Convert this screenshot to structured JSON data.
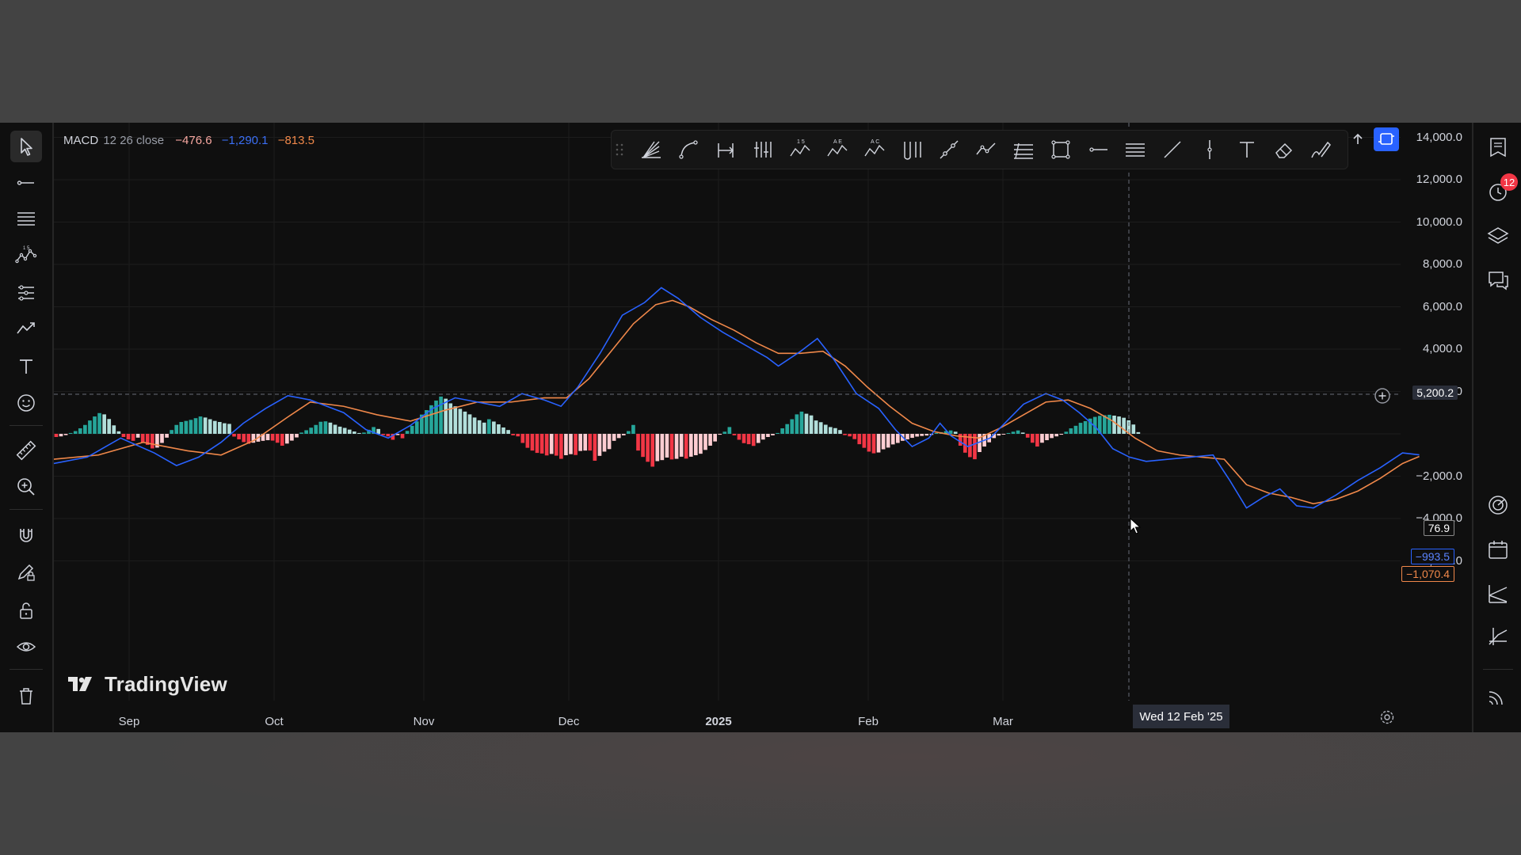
{
  "legend": {
    "indicator": "MACD",
    "params": "12 26 close",
    "histogram_value": "−476.6",
    "macd_value": "−1,290.1",
    "signal_value": "−813.5"
  },
  "price_axis": {
    "labels": [
      "14,000.0",
      "12,000.0",
      "10,000.0",
      "8,000.0",
      "6,000.0",
      "4,000.0",
      "2,000.0",
      "−2,000.0",
      "−4,000.0",
      "−6,000.0"
    ],
    "crosshair_value": "5,200.2",
    "histogram_badge": "76.9",
    "macd_badge": "−993.5",
    "signal_badge": "−1,070.4"
  },
  "time_axis": {
    "labels": [
      "Sep",
      "Oct",
      "Nov",
      "Dec",
      "2025",
      "Feb",
      "Mar"
    ],
    "crosshair_date": "Wed 12 Feb '25"
  },
  "logo": {
    "text": "TradingView"
  },
  "notifications": {
    "count": "12"
  },
  "colors": {
    "macd_line": "#2962ff",
    "signal_line": "#f0884a",
    "hist_pos_strong": "#26a69a",
    "hist_pos_weak": "#b2dfdb",
    "hist_neg_strong": "#f23645",
    "hist_neg_weak": "#ffcdd2",
    "accent": "#2962ff"
  },
  "chart_data": {
    "type": "line",
    "indicator": "MACD 12 26 close",
    "ylim": [
      -6500,
      14500
    ],
    "x_labels": [
      "Sep",
      "Oct",
      "Nov",
      "Dec",
      "2025",
      "Feb",
      "Mar"
    ],
    "macd_points": [
      [
        0,
        -1400
      ],
      [
        0.03,
        -1100
      ],
      [
        0.06,
        -200
      ],
      [
        0.09,
        -900
      ],
      [
        0.11,
        -1500
      ],
      [
        0.13,
        -1100
      ],
      [
        0.15,
        -400
      ],
      [
        0.17,
        500
      ],
      [
        0.19,
        1200
      ],
      [
        0.21,
        1800
      ],
      [
        0.23,
        1600
      ],
      [
        0.26,
        1000
      ],
      [
        0.28,
        200
      ],
      [
        0.3,
        -200
      ],
      [
        0.32,
        400
      ],
      [
        0.34,
        1200
      ],
      [
        0.36,
        1700
      ],
      [
        0.38,
        1500
      ],
      [
        0.4,
        1300
      ],
      [
        0.42,
        1900
      ],
      [
        0.44,
        1600
      ],
      [
        0.455,
        1300
      ],
      [
        0.47,
        2200
      ],
      [
        0.49,
        3800
      ],
      [
        0.51,
        5600
      ],
      [
        0.53,
        6200
      ],
      [
        0.545,
        6900
      ],
      [
        0.56,
        6400
      ],
      [
        0.58,
        5500
      ],
      [
        0.6,
        4800
      ],
      [
        0.62,
        4200
      ],
      [
        0.64,
        3600
      ],
      [
        0.65,
        3200
      ],
      [
        0.67,
        3900
      ],
      [
        0.685,
        4500
      ],
      [
        0.7,
        3500
      ],
      [
        0.72,
        1900
      ],
      [
        0.74,
        1200
      ],
      [
        0.755,
        200
      ],
      [
        0.77,
        -600
      ],
      [
        0.785,
        -200
      ],
      [
        0.795,
        500
      ],
      [
        0.805,
        -100
      ],
      [
        0.82,
        -600
      ],
      [
        0.84,
        -200
      ],
      [
        0.855,
        600
      ],
      [
        0.87,
        1400
      ],
      [
        0.89,
        1900
      ],
      [
        0.905,
        1600
      ],
      [
        0.92,
        1000
      ],
      [
        0.935,
        300
      ],
      [
        0.95,
        -700
      ],
      [
        0.965,
        -1100
      ],
      [
        0.98,
        -1300
      ],
      [
        1.0,
        -1200
      ],
      [
        1.02,
        -1100
      ],
      [
        1.04,
        -1000
      ],
      [
        1.055,
        -2200
      ],
      [
        1.07,
        -3500
      ],
      [
        1.085,
        -3000
      ],
      [
        1.1,
        -2600
      ],
      [
        1.115,
        -3400
      ],
      [
        1.13,
        -3500
      ],
      [
        1.15,
        -2900
      ],
      [
        1.17,
        -2200
      ],
      [
        1.19,
        -1600
      ],
      [
        1.21,
        -900
      ],
      [
        1.225,
        -993
      ]
    ],
    "signal_points": [
      [
        0,
        -1200
      ],
      [
        0.04,
        -1000
      ],
      [
        0.08,
        -400
      ],
      [
        0.12,
        -800
      ],
      [
        0.15,
        -1000
      ],
      [
        0.18,
        -300
      ],
      [
        0.21,
        800
      ],
      [
        0.23,
        1500
      ],
      [
        0.26,
        1300
      ],
      [
        0.29,
        900
      ],
      [
        0.32,
        600
      ],
      [
        0.35,
        1100
      ],
      [
        0.38,
        1500
      ],
      [
        0.41,
        1500
      ],
      [
        0.44,
        1700
      ],
      [
        0.46,
        1700
      ],
      [
        0.48,
        2600
      ],
      [
        0.5,
        3900
      ],
      [
        0.52,
        5200
      ],
      [
        0.54,
        6100
      ],
      [
        0.555,
        6300
      ],
      [
        0.57,
        6000
      ],
      [
        0.59,
        5400
      ],
      [
        0.61,
        4900
      ],
      [
        0.63,
        4300
      ],
      [
        0.65,
        3800
      ],
      [
        0.67,
        3800
      ],
      [
        0.69,
        3900
      ],
      [
        0.71,
        3200
      ],
      [
        0.73,
        2200
      ],
      [
        0.75,
        1300
      ],
      [
        0.77,
        500
      ],
      [
        0.79,
        100
      ],
      [
        0.81,
        -100
      ],
      [
        0.83,
        -200
      ],
      [
        0.85,
        300
      ],
      [
        0.87,
        900
      ],
      [
        0.89,
        1500
      ],
      [
        0.91,
        1600
      ],
      [
        0.93,
        1200
      ],
      [
        0.95,
        600
      ],
      [
        0.97,
        -200
      ],
      [
        0.99,
        -800
      ],
      [
        1.01,
        -1000
      ],
      [
        1.03,
        -1100
      ],
      [
        1.05,
        -1200
      ],
      [
        1.07,
        -2400
      ],
      [
        1.09,
        -2800
      ],
      [
        1.11,
        -3000
      ],
      [
        1.13,
        -3300
      ],
      [
        1.15,
        -3100
      ],
      [
        1.17,
        -2700
      ],
      [
        1.19,
        -2100
      ],
      [
        1.21,
        -1400
      ],
      [
        1.225,
        -1070
      ]
    ],
    "histogram": [
      -150,
      -120,
      -60,
      40,
      130,
      260,
      420,
      630,
      820,
      980,
      920,
      700,
      400,
      120,
      -150,
      -260,
      -330,
      -180,
      -400,
      -520,
      -690,
      -650,
      -430,
      -180,
      180,
      420,
      560,
      610,
      660,
      740,
      820,
      770,
      690,
      610,
      560,
      500,
      470,
      -130,
      -260,
      -390,
      -470,
      -420,
      -370,
      -330,
      -300,
      -320,
      -420,
      -560,
      -460,
      -320,
      -170,
      60,
      170,
      290,
      420,
      570,
      590,
      530,
      430,
      340,
      280,
      200,
      110,
      40,
      60,
      190,
      320,
      230,
      -60,
      -120,
      -280,
      -60,
      -210,
      140,
      380,
      590,
      910,
      1120,
      1350,
      1570,
      1760,
      1660,
      1440,
      1300,
      1180,
      1050,
      920,
      770,
      640,
      530,
      690,
      580,
      450,
      300,
      180,
      -70,
      -120,
      -430,
      -660,
      -790,
      -900,
      -930,
      -1020,
      -950,
      -1030,
      -1180,
      -1010,
      -960,
      -1000,
      -810,
      -790,
      -790,
      -1270,
      -1040,
      -840,
      -720,
      -330,
      -200,
      -70,
      130,
      420,
      -790,
      -1090,
      -1320,
      -1550,
      -1290,
      -1240,
      -1120,
      -1210,
      -1180,
      -1080,
      -1170,
      -1080,
      -1010,
      -940,
      -760,
      -560,
      -360,
      -40,
      100,
      320,
      -70,
      -280,
      -440,
      -490,
      -570,
      -430,
      -270,
      -150,
      -70,
      40,
      260,
      460,
      690,
      920,
      1050,
      950,
      870,
      630,
      550,
      430,
      320,
      270,
      180,
      -60,
      -120,
      -250,
      -490,
      -660,
      -840,
      -920,
      -880,
      -730,
      -650,
      -500,
      -430,
      -330,
      -260,
      -190,
      -130,
      -100,
      -80,
      -50,
      40,
      80,
      130,
      160,
      100,
      -560,
      -890,
      -1100,
      -1200,
      -860,
      -600,
      -400,
      -200,
      -80,
      -20,
      40,
      100,
      160,
      60,
      -180,
      -420,
      -600,
      -420,
      -300,
      -200,
      -120,
      -40,
      100,
      260,
      380,
      520,
      600,
      720,
      800,
      850,
      880,
      900,
      860,
      820,
      760,
      640,
      440,
      80
    ]
  }
}
